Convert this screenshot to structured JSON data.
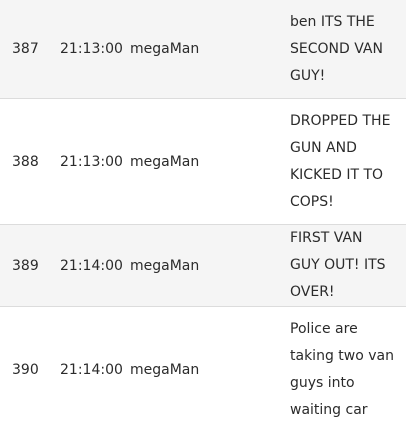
{
  "rows": [
    {
      "id": "387",
      "time": "21:13:00",
      "user": "megaMan",
      "message": "ben ITS THE SECOND VAN GUY!"
    },
    {
      "id": "388",
      "time": "21:13:00",
      "user": "megaMan",
      "message": "DROPPED THE GUN AND KICKED IT TO COPS!"
    },
    {
      "id": "389",
      "time": "21:14:00",
      "user": "megaMan",
      "message": "FIRST VAN GUY OUT! ITS OVER!"
    },
    {
      "id": "390",
      "time": "21:14:00",
      "user": "megaMan",
      "message": "Police are taking two van guys into waiting car"
    }
  ]
}
